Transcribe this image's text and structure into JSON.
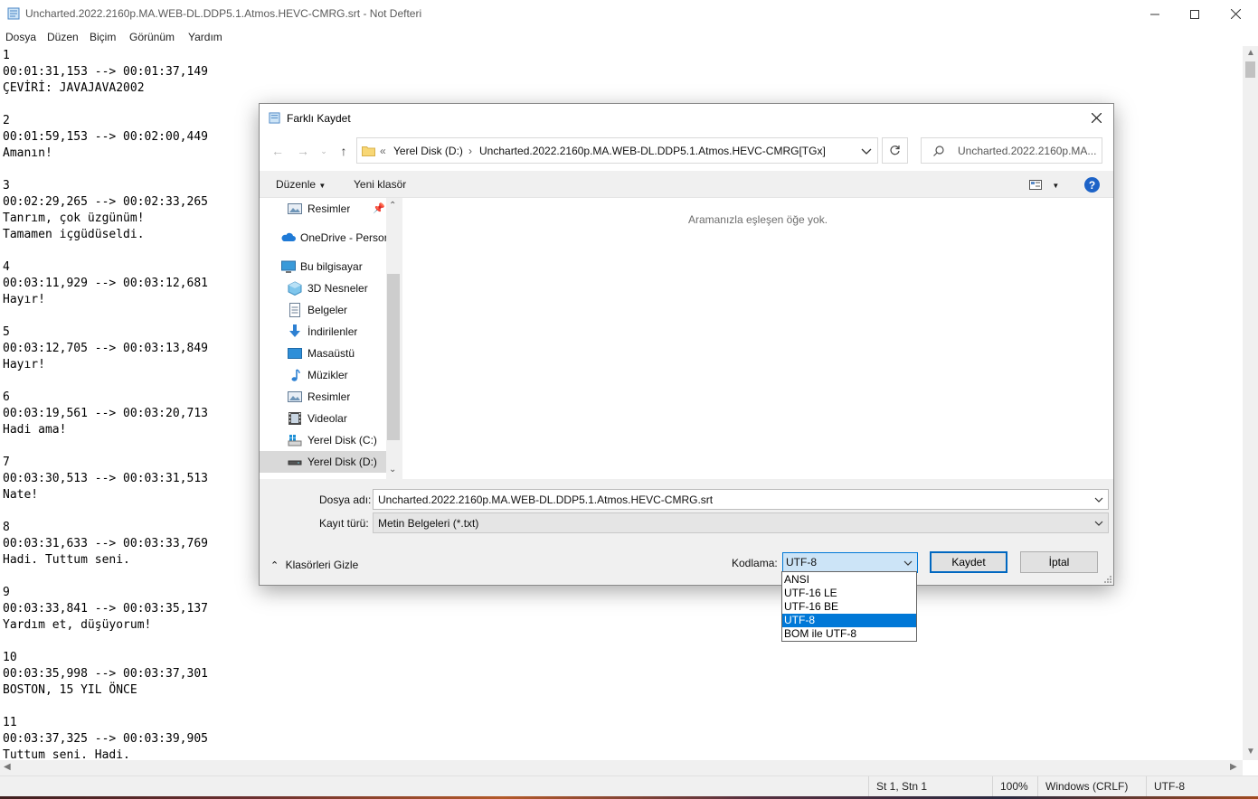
{
  "notepad": {
    "title": "Uncharted.2022.2160p.MA.WEB-DL.DDP5.1.Atmos.HEVC-CMRG.srt - Not Defteri",
    "menu": [
      "Dosya",
      "Düzen",
      "Biçim",
      "Görünüm",
      "Yardım"
    ],
    "content": "1\n00:01:31,153 --> 00:01:37,149\nÇEVİRİ: JAVAJAVA2002\n\n2\n00:01:59,153 --> 00:02:00,449\nAmanın!\n\n3\n00:02:29,265 --> 00:02:33,265\nTanrım, çok üzgünüm!\nTamamen içgüdüseldi.\n\n4\n00:03:11,929 --> 00:03:12,681\nHayır!\n\n5\n00:03:12,705 --> 00:03:13,849\nHayır!\n\n6\n00:03:19,561 --> 00:03:20,713\nHadi ama!\n\n7\n00:03:30,513 --> 00:03:31,513\nNate!\n\n8\n00:03:31,633 --> 00:03:33,769\nHadi. Tuttum seni.\n\n9\n00:03:33,841 --> 00:03:35,137\nYardım et, düşüyorum!\n\n10\n00:03:35,998 --> 00:03:37,301\nBOSTON, 15 YIL ÖNCE\n\n11\n00:03:37,325 --> 00:03:39,905\nTuttum seni. Hadi.",
    "status": {
      "position": "St 1, Stn 1",
      "zoom": "100%",
      "line_endings": "Windows (CRLF)",
      "encoding": "UTF-8"
    }
  },
  "dialog": {
    "title": "Farklı Kaydet",
    "address": {
      "overflow": "«",
      "drive": "Yerel Disk (D:)",
      "folder": "Uncharted.2022.2160p.MA.WEB-DL.DDP5.1.Atmos.HEVC-CMRG[TGx]"
    },
    "search_placeholder": "Uncharted.2022.2160p.MA....",
    "toolbar": {
      "organize": "Düzenle",
      "new_folder": "Yeni klasör"
    },
    "nav_items": [
      {
        "label": "Resimler",
        "icon": "pictures-icon",
        "pinned": true
      },
      {
        "label": "OneDrive - Persor",
        "icon": "onedrive-icon"
      },
      {
        "label": "Bu bilgisayar",
        "icon": "this-pc-icon"
      },
      {
        "label": "3D Nesneler",
        "icon": "3d-objects-icon"
      },
      {
        "label": "Belgeler",
        "icon": "documents-icon"
      },
      {
        "label": "İndirilenler",
        "icon": "downloads-icon"
      },
      {
        "label": "Masaüstü",
        "icon": "desktop-icon"
      },
      {
        "label": "Müzikler",
        "icon": "music-icon"
      },
      {
        "label": "Resimler",
        "icon": "pictures-icon"
      },
      {
        "label": "Videolar",
        "icon": "videos-icon"
      },
      {
        "label": "Yerel Disk (C:)",
        "icon": "drive-c-icon"
      },
      {
        "label": "Yerel Disk (D:)",
        "icon": "drive-d-icon",
        "selected": true
      }
    ],
    "empty_message": "Aramanızla eşleşen öğe yok.",
    "filename_label": "Dosya adı:",
    "filename": "Uncharted.2022.2160p.MA.WEB-DL.DDP5.1.Atmos.HEVC-CMRG.srt",
    "filetype_label": "Kayıt türü:",
    "filetype": "Metin Belgeleri (*.txt)",
    "hide_folders": "Klasörleri Gizle",
    "encoding_label": "Kodlama:",
    "encoding_value": "UTF-8",
    "save_button": "Kaydet",
    "cancel_button": "İptal",
    "encoding_options": [
      "ANSI",
      "UTF-16 LE",
      "UTF-16 BE",
      "UTF-8",
      "BOM ile UTF-8"
    ],
    "encoding_selected": "UTF-8"
  },
  "colors": {
    "accent": "#0078d7",
    "help": "#1d63c7"
  }
}
